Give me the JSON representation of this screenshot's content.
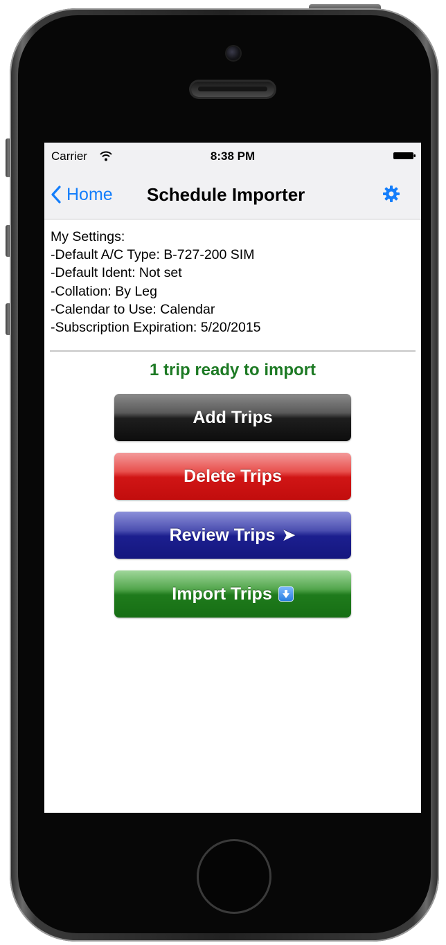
{
  "status_bar": {
    "carrier": "Carrier",
    "time": "8:38 PM",
    "wifi_icon": "wifi-icon",
    "battery_icon": "battery-icon"
  },
  "nav_bar": {
    "back_label": "Home",
    "title": "Schedule Importer",
    "settings_icon": "gear-icon",
    "accent_color": "#147efb"
  },
  "settings": {
    "lines": [
      "My Settings:",
      "-Default A/C Type: B-727-200 SIM",
      "-Default Ident: Not set",
      "-Collation: By Leg",
      "-Calendar to Use: Calendar",
      "-Subscription Expiration: 5/20/2015"
    ]
  },
  "status_message": {
    "text": "1 trip ready to import",
    "color": "#1d7a24"
  },
  "buttons": {
    "add": {
      "label": "Add Trips",
      "color": "#1e1e1e"
    },
    "delete": {
      "label": "Delete Trips",
      "color": "#d01515"
    },
    "review": {
      "label": "Review Trips",
      "icon": "➤",
      "color": "#1c1f8f"
    },
    "import": {
      "label": "Import Trips",
      "icon": "download-icon",
      "color": "#1f7b1c"
    }
  }
}
